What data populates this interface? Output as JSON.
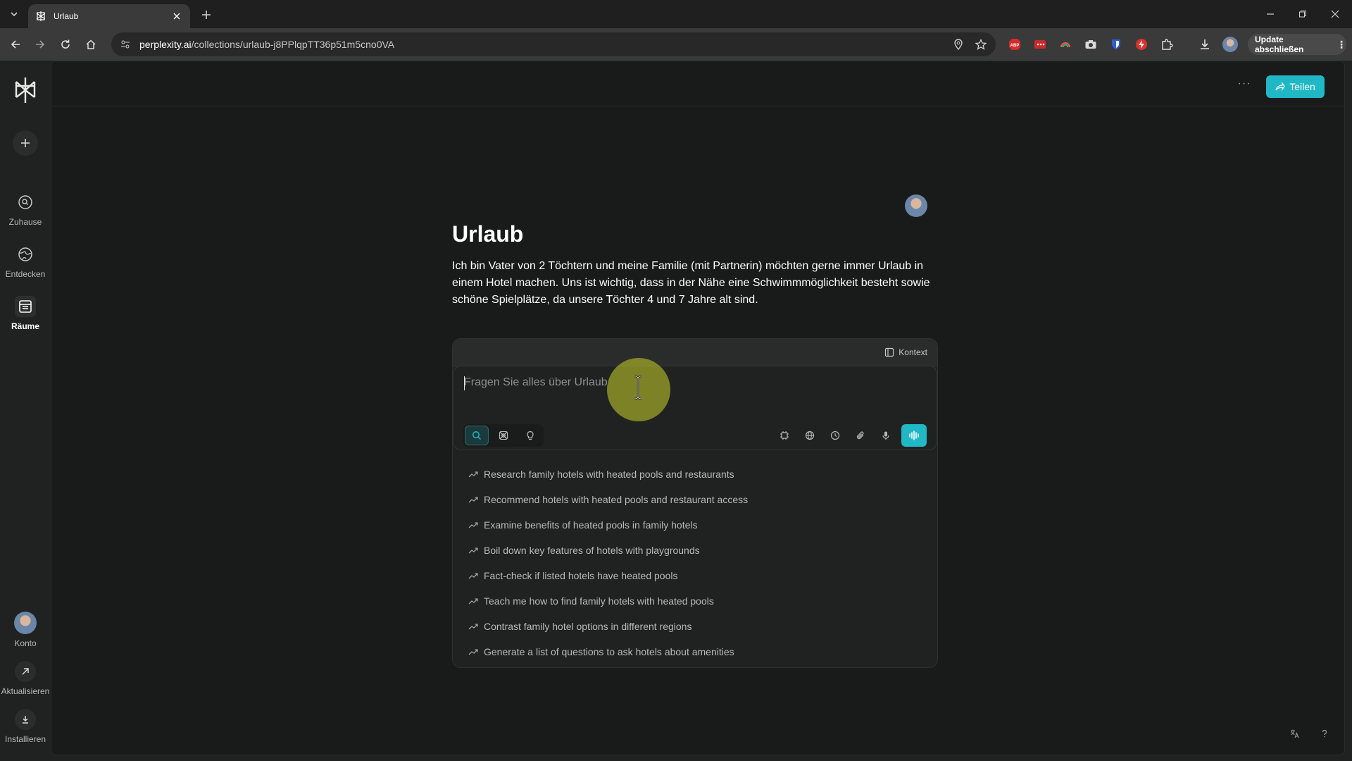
{
  "browser": {
    "tab_title": "Urlaub",
    "url_host": "perplexity.ai",
    "url_path": "/collections/urlaub-j8PPlqpTT36p51m5cno0VA",
    "update_label": "Update abschließen",
    "extensions": [
      "abp-icon",
      "lastpass-icon",
      "rainbow-icon",
      "camera-icon",
      "bitwarden-icon",
      "flash-icon",
      "extensions-puzzle-icon",
      "download-icon",
      "profile-icon"
    ]
  },
  "sidebar": {
    "items": [
      {
        "label": "Zuhause",
        "icon": "search-circle-icon"
      },
      {
        "label": "Entdecken",
        "icon": "globe-icon"
      },
      {
        "label": "Räume",
        "icon": "spaces-icon"
      }
    ],
    "account_label": "Konto",
    "upgrade_label": "Aktualisieren",
    "install_label": "Installieren"
  },
  "header": {
    "share_label": "Teilen",
    "more_label": "···"
  },
  "space": {
    "title": "Urlaub",
    "description": "Ich bin Vater von 2 Töchtern und meine Familie (mit Partnerin) möchten gerne immer Urlaub in einem Hotel machen. Uns ist wichtig, dass in der Nähe eine Schwimmmöglichkeit besteht sowie schöne Spielplätze, da unsere Töchter 4 und 7 Jahre alt sind."
  },
  "composer": {
    "context_label": "Kontext",
    "placeholder": "Fragen Sie alles über Urlaub",
    "value": ""
  },
  "suggestions": [
    "Research family hotels with heated pools and restaurants",
    "Recommend hotels with heated pools and restaurant access",
    "Examine benefits of heated pools in family hotels",
    "Boil down key features of hotels with playgrounds",
    "Fact-check if listed hotels have heated pools",
    "Teach me how to find family hotels with heated pools",
    "Contrast family hotel options in different regions",
    "Generate a list of questions to ask hotels about amenities"
  ],
  "colors": {
    "accent": "#20b8c5",
    "background": "#191a1a",
    "sidebar": "#202222"
  }
}
